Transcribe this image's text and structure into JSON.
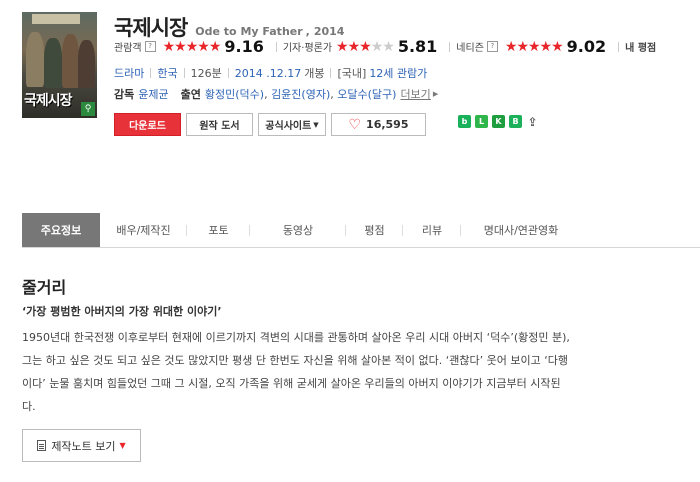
{
  "movie": {
    "title_ko": "국제시장",
    "title_en": "Ode to My Father",
    "year": "2014",
    "poster_title": "국제시장"
  },
  "ratings": [
    {
      "label": "관람객",
      "score": "9.16",
      "stars": 4.5
    },
    {
      "label": "기자·평론가",
      "score": "5.81",
      "stars": 3
    },
    {
      "label": "네티즌",
      "score": "9.02",
      "stars": 4.5
    },
    {
      "label": "내 평점"
    }
  ],
  "meta": {
    "genre": "드라마",
    "country": "한국",
    "runtime": "126분",
    "release": "2014 .12.17",
    "release_suffix": "개봉",
    "rating_prefix": "[국내]",
    "rating": "12세 관람가"
  },
  "credits": {
    "director_label": "감독",
    "director": "윤제균",
    "cast_label": "출연",
    "cast": [
      "황정민(덕수)",
      "김윤진(영자)",
      "오달수(달구)"
    ],
    "more": "더보기"
  },
  "buttons": {
    "download": "다운로드",
    "original_book": "원작 도서",
    "official_site": "공식사이트",
    "likes": "16,595"
  },
  "share_icons": [
    "blog-icon",
    "line-icon",
    "kakaotalk-icon",
    "band-icon",
    "share-icon"
  ],
  "tabs": [
    "주요정보",
    "배우/제작진",
    "포토",
    "동영상",
    "평점",
    "리뷰",
    "명대사/연관영화"
  ],
  "synopsis": {
    "heading": "줄거리",
    "tagline": "‘가장 평범한 아버지의 가장 위대한 이야기’",
    "lines": [
      "1950년대 한국전쟁 이후로부터 현재에 이르기까지 격변의 시대를 관통하며 살아온 우리 시대 아버지 ‘덕수’(황정민 분),",
      "그는 하고 싶은 것도 되고 싶은 것도 많았지만 평생 단 한번도 자신을 위해 살아본 적이 없다. ‘괜찮다’ 웃어 보이고 ‘다행",
      "이다’ 눈물 훔치며 힘들었던 그때 그 시절, 오직 가족을 위해 굳세게 살아온 우리들의 아버지 이야기가 지금부터 시작된",
      "다."
    ],
    "notes_button": "제작노트 보기"
  },
  "colors": {
    "accent_red": "#e8323a",
    "link_blue": "#2e63b5",
    "tab_active": "#777777"
  }
}
